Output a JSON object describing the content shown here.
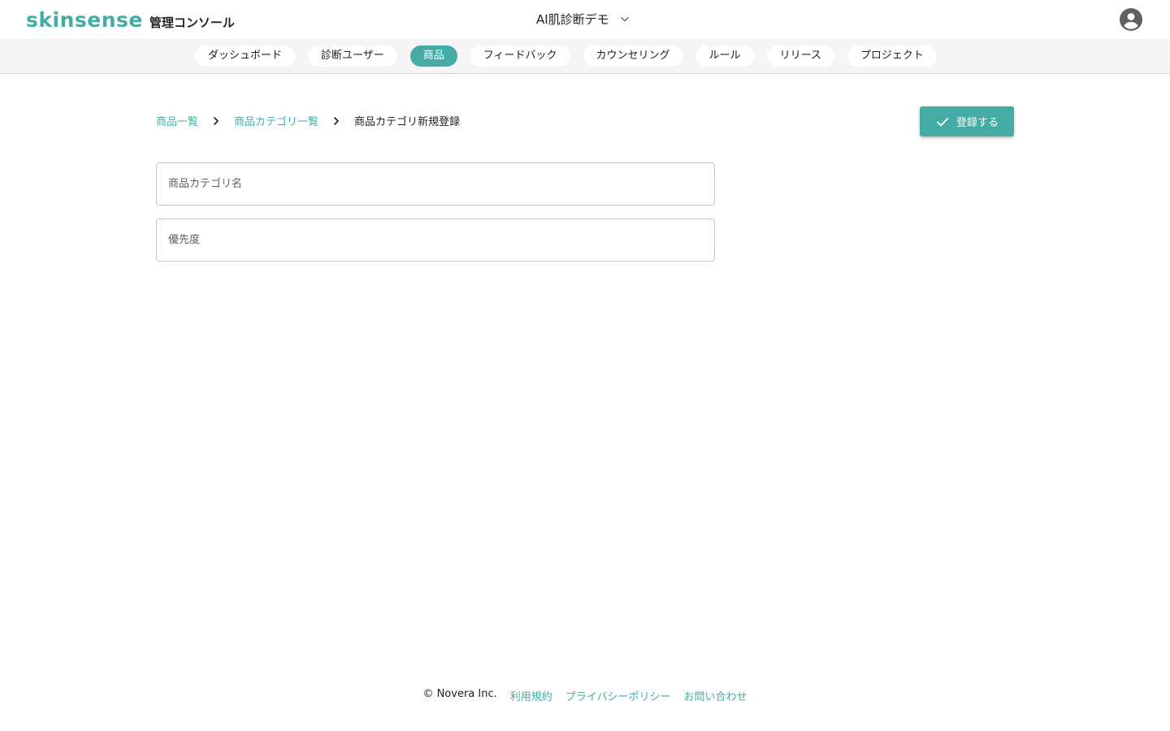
{
  "header": {
    "brand": "skinsense",
    "console_label": "管理コンソール",
    "project_name": "AI肌診断デモ"
  },
  "nav": {
    "tabs": [
      {
        "label": "ダッシュボード",
        "active": false
      },
      {
        "label": "診断ユーザー",
        "active": false
      },
      {
        "label": "商品",
        "active": true
      },
      {
        "label": "フィードバック",
        "active": false
      },
      {
        "label": "カウンセリング",
        "active": false
      },
      {
        "label": "ルール",
        "active": false
      },
      {
        "label": "リリース",
        "active": false
      },
      {
        "label": "プロジェクト",
        "active": false
      }
    ]
  },
  "breadcrumb": {
    "items": [
      "商品一覧",
      "商品カテゴリ一覧"
    ],
    "current": "商品カテゴリ新規登録"
  },
  "toolbar": {
    "submit_label": "登録する"
  },
  "form": {
    "category_name": {
      "placeholder": "商品カテゴリ名",
      "value": ""
    },
    "priority": {
      "placeholder": "優先度",
      "value": ""
    }
  },
  "footer": {
    "copyright": "© Novera Inc.",
    "links": [
      "利用規約",
      "プライバシーポリシー",
      "お問い合わせ"
    ]
  },
  "colors": {
    "accent": "#45aca5",
    "nav_bg": "#f5f5f5",
    "text": "#212121"
  }
}
